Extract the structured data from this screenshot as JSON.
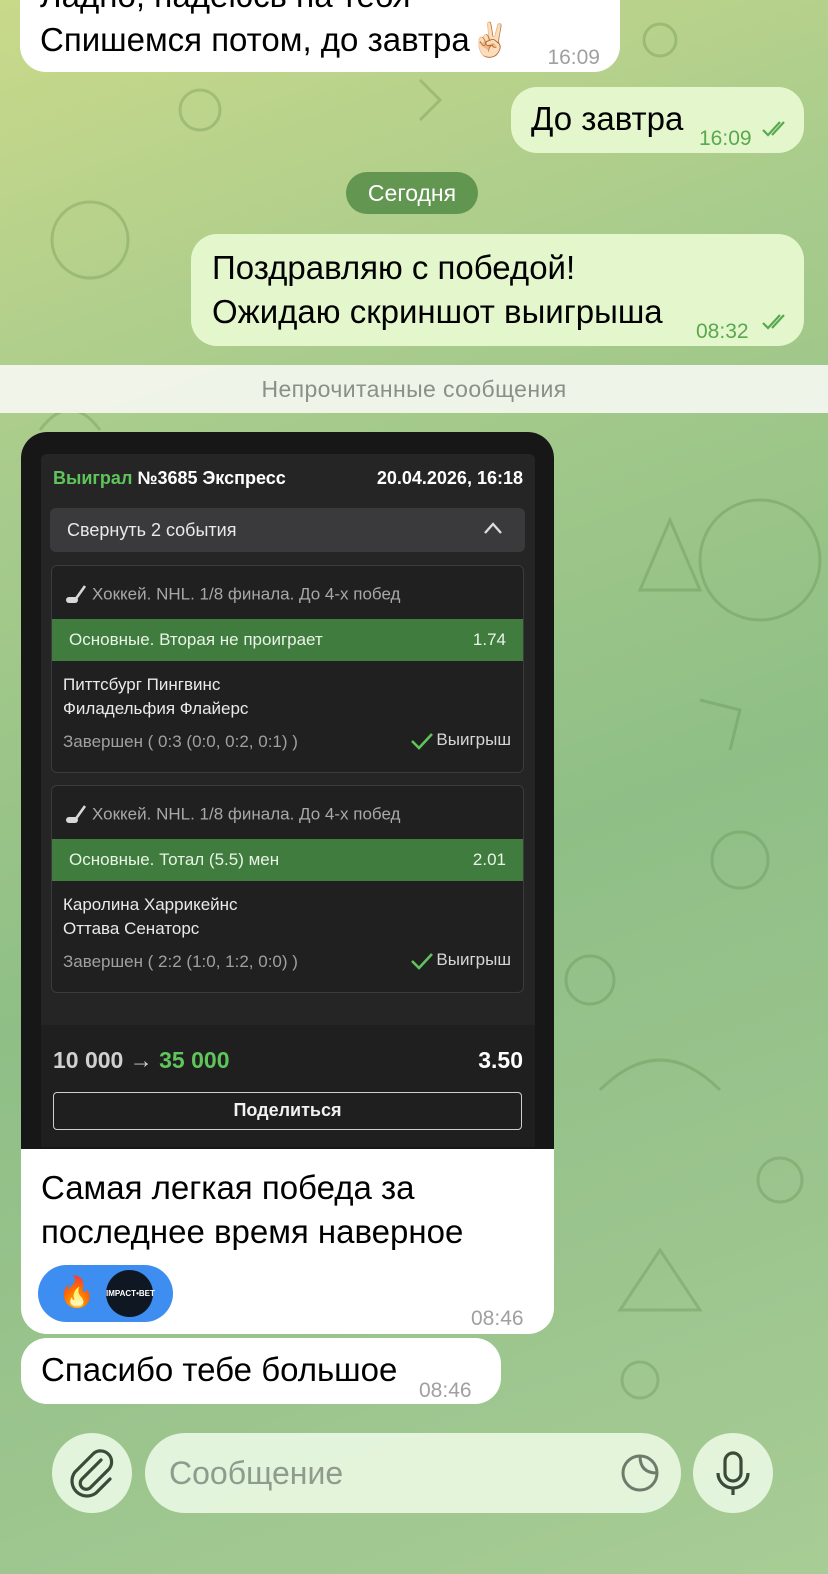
{
  "messages": {
    "m1": {
      "text_partial": "Ладно, надеюсь на тебя",
      "text": "Спишемся потом, до завтра",
      "emoji": "✌🏻",
      "time": "16:09"
    },
    "m2": {
      "text": "До завтра",
      "time": "16:09"
    },
    "date_separator": "Сегодня",
    "m3": {
      "line1": "Поздравляю с победой!",
      "line2": "Ожидаю скриншот выигрыша",
      "time": "08:32"
    },
    "unread_label": "Непрочитанные сообщения",
    "m4": {
      "caption_line1": "Самая легкая победа за",
      "caption_line2": "последнее время наверное",
      "time": "08:46",
      "reactions": {
        "emoji": "🔥",
        "avatar_label": "IMPACT•BET"
      }
    },
    "m5": {
      "text": "Спасибо тебе большое",
      "time": "08:46"
    }
  },
  "bet_slip": {
    "status": "Выиграл",
    "number": "№3685 Экспресс",
    "datetime": "20.04.2026, 16:18",
    "collapse_label": "Свернуть 2 события",
    "events": [
      {
        "sport": "Хоккей. NHL. 1/8 финала. До 4-х побед",
        "pick": "Основные. Вторая не проиграет",
        "odd": "1.74",
        "team1": "Питтсбург Пингвинс",
        "team2": "Филадельфия Флайерс",
        "status": "Завершен ( 0:3 (0:0, 0:2, 0:1) )",
        "result": "Выигрыш"
      },
      {
        "sport": "Хоккей. NHL. 1/8 финала. До 4-х побед",
        "pick": "Основные. Тотал (5.5) мен",
        "odd": "2.01",
        "team1": "Каролина Харрикейнс",
        "team2": "Оттава Сенаторс",
        "status": "Завершен ( 2:2 (1:0, 1:2, 0:0) )",
        "result": "Выигрыш"
      }
    ],
    "stake": "10 000",
    "arrow": "→",
    "payout": "35 000",
    "total_odd": "3.50",
    "share_label": "Поделиться"
  },
  "composer": {
    "placeholder": "Сообщение",
    "attach_icon": "paperclip-icon",
    "sticker_icon": "sticker-icon",
    "mic_icon": "microphone-icon"
  },
  "colors": {
    "outgoing_bubble": "#e4f7cc",
    "incoming_bubble": "#ffffff",
    "accent_green": "#5fc45b",
    "pick_bar": "#3f7c3d",
    "reaction_blue": "#3d8ef0"
  }
}
